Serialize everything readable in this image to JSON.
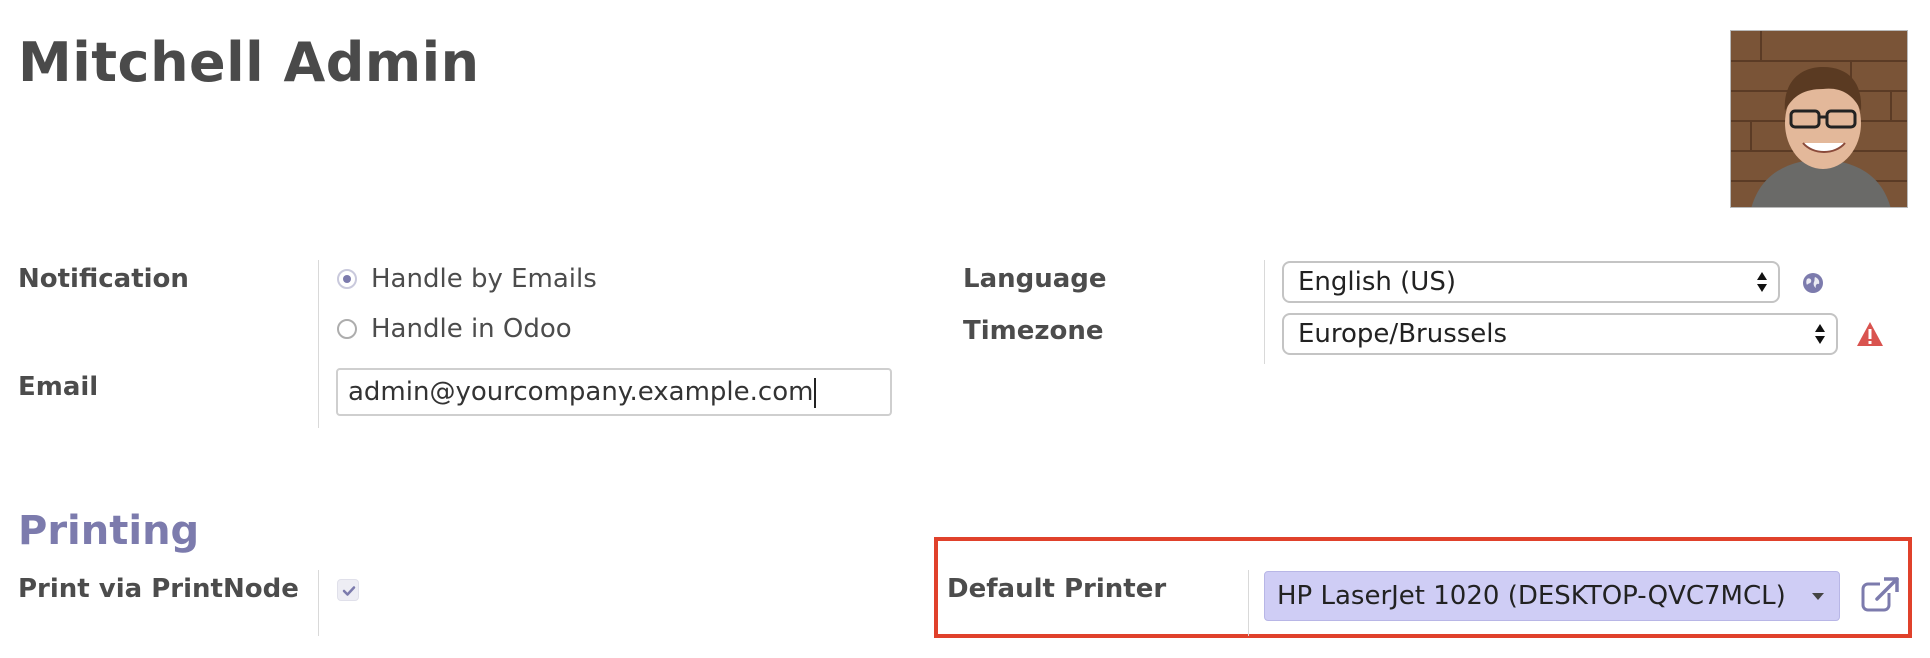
{
  "record": {
    "name": "Mitchell Admin"
  },
  "avatar": {
    "alt_icon": "user-photo"
  },
  "fields": {
    "notification": {
      "label": "Notification",
      "options": [
        "Handle by Emails",
        "Handle in Odoo"
      ],
      "selected": "Handle by Emails"
    },
    "email": {
      "label": "Email",
      "value": "admin@yourcompany.example.com"
    },
    "language": {
      "label": "Language",
      "value": "English (US)",
      "icon": "globe-icon"
    },
    "timezone": {
      "label": "Timezone",
      "value": "Europe/Brussels",
      "icon": "warning-icon"
    }
  },
  "printing": {
    "section_title": "Printing",
    "print_via_printnode": {
      "label": "Print via PrintNode",
      "checked": true
    },
    "default_printer": {
      "label": "Default Printer",
      "value": "HP LaserJet 1020 (DESKTOP-QVC7MCL)",
      "icon": "external-link-icon"
    }
  },
  "colors": {
    "accent": "#7c7bad",
    "highlight_border": "#e0412b",
    "warning": "#d9534f",
    "printer_select_bg": "#cfcdf5"
  }
}
